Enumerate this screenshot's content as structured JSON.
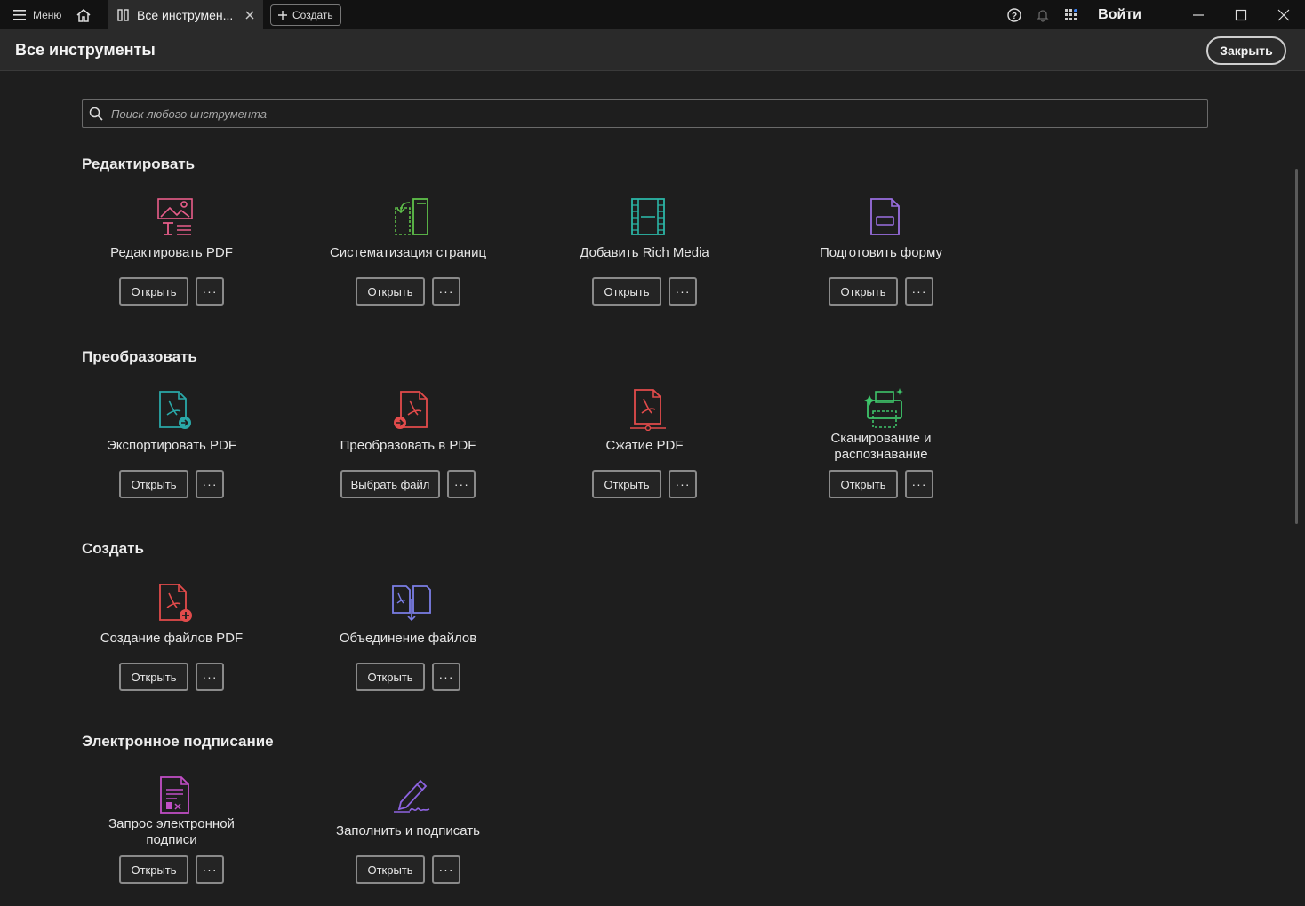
{
  "titlebar": {
    "menu_label": "Меню",
    "tab_label": "Все инструмен...",
    "create_label": "Создать",
    "signin_label": "Войти"
  },
  "header": {
    "title": "Все инструменты",
    "close_label": "Закрыть"
  },
  "search": {
    "placeholder": "Поиск любого инструмента"
  },
  "colors": {
    "edit_pink": "#e85d8a",
    "organize_green": "#5fc04a",
    "richmedia_teal": "#2bb5a6",
    "form_purple": "#9a6ee0",
    "export_teal": "#2aa8a8",
    "pdf_red": "#e24b4b",
    "scan_green": "#3ec46a",
    "combine_blue": "#7b7ee6",
    "sign_magenta": "#c24fc7"
  },
  "sections": [
    {
      "title": "Редактировать",
      "tools": [
        {
          "label": "Редактировать PDF",
          "icon": "edit-pdf-icon",
          "button": "Открыть"
        },
        {
          "label": "Систематизация страниц",
          "icon": "organize-pages-icon",
          "button": "Открыть"
        },
        {
          "label": "Добавить Rich Media",
          "icon": "rich-media-icon",
          "button": "Открыть"
        },
        {
          "label": "Подготовить форму",
          "icon": "prepare-form-icon",
          "button": "Открыть"
        }
      ]
    },
    {
      "title": "Преобразовать",
      "tools": [
        {
          "label": "Экспортировать PDF",
          "icon": "export-pdf-icon",
          "button": "Открыть"
        },
        {
          "label": "Преобразовать в PDF",
          "icon": "convert-to-pdf-icon",
          "button": "Выбрать файл"
        },
        {
          "label": "Сжатие PDF",
          "icon": "compress-pdf-icon",
          "button": "Открыть"
        },
        {
          "label_line1": "Сканирование и",
          "label_line2": "распознавание",
          "icon": "scan-ocr-icon",
          "button": "Открыть"
        }
      ]
    },
    {
      "title": "Создать",
      "tools": [
        {
          "label": "Создание файлов PDF",
          "icon": "create-pdf-icon",
          "button": "Открыть"
        },
        {
          "label": "Объединение файлов",
          "icon": "combine-files-icon",
          "button": "Открыть"
        }
      ]
    },
    {
      "title": "Электронное подписание",
      "tools": [
        {
          "label_line1": "Запрос электронной",
          "label_line2": "подписи",
          "icon": "request-esign-icon",
          "button": "Открыть"
        },
        {
          "label": "Заполнить и подписать",
          "icon": "fill-sign-icon",
          "button": "Открыть"
        }
      ]
    }
  ]
}
